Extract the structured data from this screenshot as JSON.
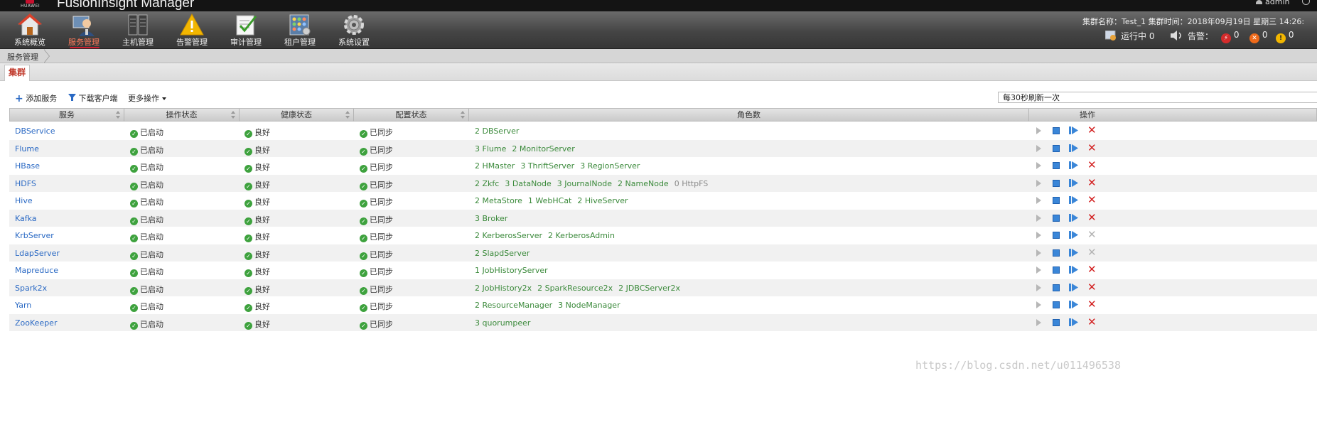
{
  "app": {
    "logo_text": "HUAWEI",
    "title": "FusionInsight Manager",
    "user": "admin"
  },
  "nav": [
    {
      "label": "系统概览",
      "icon": "house-icon"
    },
    {
      "label": "服务管理",
      "icon": "service-admin-icon",
      "active": true
    },
    {
      "label": "主机管理",
      "icon": "server-rack-icon"
    },
    {
      "label": "告警管理",
      "icon": "warning-triangle-icon"
    },
    {
      "label": "审计管理",
      "icon": "audit-checklist-icon"
    },
    {
      "label": "租户管理",
      "icon": "tenant-grid-icon"
    },
    {
      "label": "系统设置",
      "icon": "gear-icon"
    }
  ],
  "cluster": {
    "info": "集群名称：Test_1   集群时间：2018年09月19日 星期三 14:26:",
    "running_label": "运行中 0",
    "alarm_label": "告警：",
    "alarm_critical": "0",
    "alarm_major": "0",
    "alarm_minor": "0"
  },
  "breadcrumb": "服务管理",
  "tab": "集群",
  "toolbar": {
    "add_service": "添加服务",
    "download_client": "下载客户端",
    "more_actions": "更多操作",
    "refresh": "每30秒刷新一次"
  },
  "columns": {
    "service": "服务",
    "op_status": "操作状态",
    "health": "健康状态",
    "config": "配置状态",
    "roles": "角色数",
    "actions": "操作"
  },
  "rows": [
    {
      "service": "DBService",
      "op": "已启动",
      "health": "良好",
      "config": "已同步",
      "roles": [
        {
          "t": "2 DBServer",
          "c": "green"
        }
      ],
      "deletable": true
    },
    {
      "service": "Flume",
      "op": "已启动",
      "health": "良好",
      "config": "已同步",
      "roles": [
        {
          "t": "3 Flume",
          "c": "green"
        },
        {
          "t": "2 MonitorServer",
          "c": "green"
        }
      ],
      "deletable": true
    },
    {
      "service": "HBase",
      "op": "已启动",
      "health": "良好",
      "config": "已同步",
      "roles": [
        {
          "t": "2 HMaster",
          "c": "green"
        },
        {
          "t": "3 ThriftServer",
          "c": "green"
        },
        {
          "t": "3 RegionServer",
          "c": "green"
        }
      ],
      "deletable": true
    },
    {
      "service": "HDFS",
      "op": "已启动",
      "health": "良好",
      "config": "已同步",
      "roles": [
        {
          "t": "2 Zkfc",
          "c": "green"
        },
        {
          "t": "3 DataNode",
          "c": "green"
        },
        {
          "t": "3 JournalNode",
          "c": "green"
        },
        {
          "t": "2 NameNode",
          "c": "green"
        },
        {
          "t": "0 HttpFS",
          "c": "gray"
        }
      ],
      "deletable": true
    },
    {
      "service": "Hive",
      "op": "已启动",
      "health": "良好",
      "config": "已同步",
      "roles": [
        {
          "t": "2 MetaStore",
          "c": "green"
        },
        {
          "t": "1 WebHCat",
          "c": "green"
        },
        {
          "t": "2 HiveServer",
          "c": "green"
        }
      ],
      "deletable": true
    },
    {
      "service": "Kafka",
      "op": "已启动",
      "health": "良好",
      "config": "已同步",
      "roles": [
        {
          "t": "3 Broker",
          "c": "green"
        }
      ],
      "deletable": true
    },
    {
      "service": "KrbServer",
      "op": "已启动",
      "health": "良好",
      "config": "已同步",
      "roles": [
        {
          "t": "2 KerberosServer",
          "c": "green"
        },
        {
          "t": "2 KerberosAdmin",
          "c": "green"
        }
      ],
      "deletable": false
    },
    {
      "service": "LdapServer",
      "op": "已启动",
      "health": "良好",
      "config": "已同步",
      "roles": [
        {
          "t": "2 SlapdServer",
          "c": "green"
        }
      ],
      "deletable": false
    },
    {
      "service": "Mapreduce",
      "op": "已启动",
      "health": "良好",
      "config": "已同步",
      "roles": [
        {
          "t": "1 JobHistoryServer",
          "c": "green"
        }
      ],
      "deletable": true
    },
    {
      "service": "Spark2x",
      "op": "已启动",
      "health": "良好",
      "config": "已同步",
      "roles": [
        {
          "t": "2 JobHistory2x",
          "c": "green"
        },
        {
          "t": "2 SparkResource2x",
          "c": "green"
        },
        {
          "t": "2 JDBCServer2x",
          "c": "green"
        }
      ],
      "deletable": true
    },
    {
      "service": "Yarn",
      "op": "已启动",
      "health": "良好",
      "config": "已同步",
      "roles": [
        {
          "t": "2 ResourceManager",
          "c": "green"
        },
        {
          "t": "3 NodeManager",
          "c": "green"
        }
      ],
      "deletable": true
    },
    {
      "service": "ZooKeeper",
      "op": "已启动",
      "health": "良好",
      "config": "已同步",
      "roles": [
        {
          "t": "3 quorumpeer",
          "c": "green"
        }
      ],
      "deletable": true
    }
  ],
  "watermark": "https://blog.csdn.net/u011496538",
  "colors": {
    "accent_red": "#c0392b",
    "link_blue": "#2a69c4",
    "ok_green": "#3ea23e",
    "delete_red": "#d21f1f"
  }
}
